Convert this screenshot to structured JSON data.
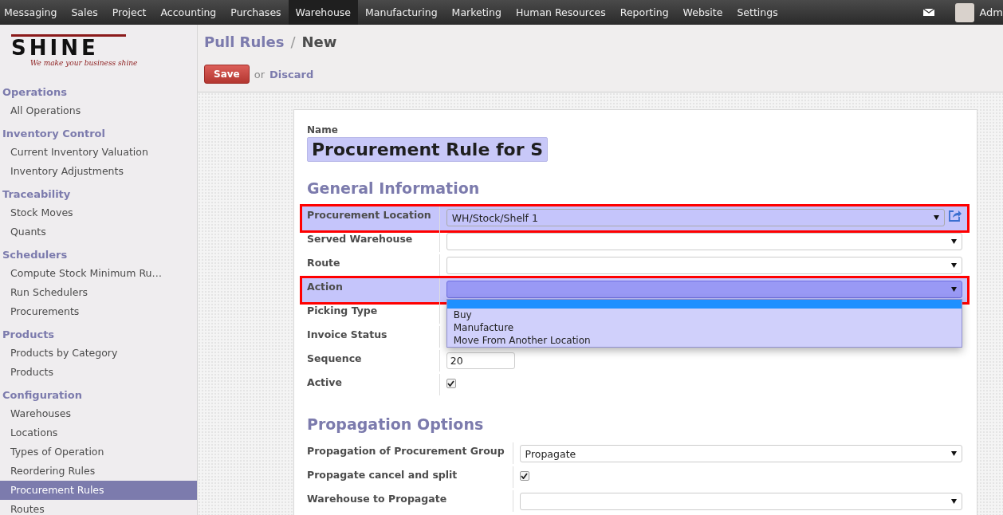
{
  "top_menu": {
    "items": [
      {
        "label": "Messaging",
        "selected": false
      },
      {
        "label": "Sales",
        "selected": false
      },
      {
        "label": "Project",
        "selected": false
      },
      {
        "label": "Accounting",
        "selected": false
      },
      {
        "label": "Purchases",
        "selected": false
      },
      {
        "label": "Warehouse",
        "selected": true
      },
      {
        "label": "Manufacturing",
        "selected": false
      },
      {
        "label": "Marketing",
        "selected": false
      },
      {
        "label": "Human Resources",
        "selected": false
      },
      {
        "label": "Reporting",
        "selected": false
      },
      {
        "label": "Website",
        "selected": false
      },
      {
        "label": "Settings",
        "selected": false
      }
    ],
    "user": "Adm"
  },
  "logo": {
    "text": "SHINE",
    "tagline": "We make your business shine"
  },
  "sidebar": {
    "sections": [
      {
        "title": "Operations",
        "items": [
          {
            "label": "All Operations",
            "selected": false
          }
        ]
      },
      {
        "title": "Inventory Control",
        "items": [
          {
            "label": "Current Inventory Valuation",
            "selected": false
          },
          {
            "label": "Inventory Adjustments",
            "selected": false
          }
        ]
      },
      {
        "title": "Traceability",
        "items": [
          {
            "label": "Stock Moves",
            "selected": false
          },
          {
            "label": "Quants",
            "selected": false
          }
        ]
      },
      {
        "title": "Schedulers",
        "items": [
          {
            "label": "Compute Stock Minimum Ru…",
            "selected": false
          },
          {
            "label": "Run Schedulers",
            "selected": false
          },
          {
            "label": "Procurements",
            "selected": false
          }
        ]
      },
      {
        "title": "Products",
        "items": [
          {
            "label": "Products by Category",
            "selected": false
          },
          {
            "label": "Products",
            "selected": false
          }
        ]
      },
      {
        "title": "Configuration",
        "items": [
          {
            "label": "Warehouses",
            "selected": false
          },
          {
            "label": "Locations",
            "selected": false
          },
          {
            "label": "Types of Operation",
            "selected": false
          },
          {
            "label": "Reordering Rules",
            "selected": false
          },
          {
            "label": "Procurement Rules",
            "selected": true
          },
          {
            "label": "Routes",
            "selected": false
          }
        ]
      }
    ]
  },
  "breadcrumb": {
    "parent": "Pull Rules",
    "separator": "/",
    "current": "New"
  },
  "actions": {
    "save": "Save",
    "or": "or",
    "discard": "Discard"
  },
  "form": {
    "name_label": "Name",
    "name_value": "Procurement Rule for S",
    "sections": [
      {
        "title": "General Information",
        "fields": [
          {
            "label": "Procurement Location",
            "kind": "select",
            "value": "WH/Stock/Shelf 1",
            "highlighted": true,
            "external_link": true
          },
          {
            "label": "Served Warehouse",
            "kind": "select",
            "highlighted": false
          },
          {
            "label": "Route",
            "kind": "select",
            "highlighted": false
          },
          {
            "label": "Action",
            "kind": "select",
            "highlighted": true,
            "open": true,
            "options": [
              {
                "selected": true
              },
              {
                "label": "Buy",
                "selected": false
              },
              {
                "label": "Manufacture",
                "selected": false
              },
              {
                "label": "Move From Another Location",
                "selected": false
              }
            ]
          },
          {
            "label": "Picking Type",
            "kind": "covered",
            "highlighted": false
          },
          {
            "label": "Invoice Status",
            "kind": "covered",
            "highlighted": false
          },
          {
            "label": "Sequence",
            "kind": "integer",
            "value": "20",
            "highlighted": false
          },
          {
            "label": "Active",
            "kind": "checkbox",
            "checked": true,
            "highlighted": false
          }
        ]
      },
      {
        "title": "Propagation Options",
        "fields": [
          {
            "label": "Propagation of Procurement Group",
            "kind": "select",
            "value": "Propagate",
            "highlighted": false
          },
          {
            "label": "Propagate cancel and split",
            "kind": "checkbox",
            "checked": true,
            "highlighted": false
          },
          {
            "label": "Warehouse to Propagate",
            "kind": "select",
            "highlighted": false
          }
        ]
      }
    ]
  }
}
